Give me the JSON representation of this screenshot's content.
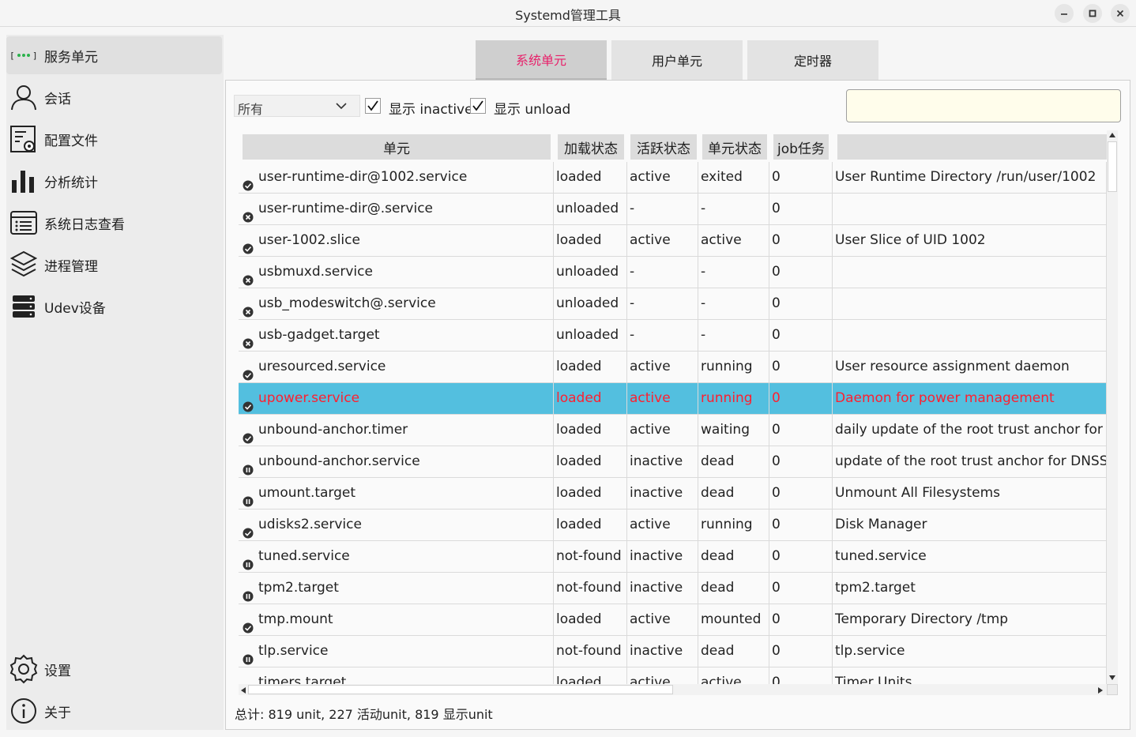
{
  "window": {
    "title": "Systemd管理工具"
  },
  "sidebar": {
    "items": [
      {
        "label": "服务单元",
        "icon": "service-units-icon"
      },
      {
        "label": "会话",
        "icon": "user-icon"
      },
      {
        "label": "配置文件",
        "icon": "config-file-icon"
      },
      {
        "label": "分析统计",
        "icon": "bar-chart-icon"
      },
      {
        "label": "系统日志查看",
        "icon": "log-list-icon"
      },
      {
        "label": "进程管理",
        "icon": "layers-icon"
      },
      {
        "label": "Udev设备",
        "icon": "server-icon"
      }
    ],
    "bottom": [
      {
        "label": "设置",
        "icon": "gear-icon"
      },
      {
        "label": "关于",
        "icon": "info-icon"
      }
    ]
  },
  "tabs": [
    {
      "label": "系统单元",
      "active": true
    },
    {
      "label": "用户单元",
      "active": false
    },
    {
      "label": "定时器",
      "active": false
    }
  ],
  "filter": {
    "selected": "所有",
    "show_inactive_label": "显示 inactive",
    "show_inactive": true,
    "show_unload_label": "显示 unload",
    "show_unload": true,
    "search_placeholder": ""
  },
  "table": {
    "columns": [
      "单元",
      "加载状态",
      "活跃状态",
      "单元状态",
      "job任务",
      ""
    ],
    "rows": [
      {
        "unit": "user-runtime-dir@1002.service",
        "load": "loaded",
        "active": "active",
        "sub": "exited",
        "job": "0",
        "desc": "User Runtime Directory /run/user/1002",
        "icon": "check"
      },
      {
        "unit": "user-runtime-dir@.service",
        "load": "unloaded",
        "active": "-",
        "sub": "-",
        "job": "0",
        "desc": "",
        "icon": "x"
      },
      {
        "unit": "user-1002.slice",
        "load": "loaded",
        "active": "active",
        "sub": "active",
        "job": "0",
        "desc": "User Slice of UID 1002",
        "icon": "check"
      },
      {
        "unit": "usbmuxd.service",
        "load": "unloaded",
        "active": "-",
        "sub": "-",
        "job": "0",
        "desc": "",
        "icon": "x"
      },
      {
        "unit": "usb_modeswitch@.service",
        "load": "unloaded",
        "active": "-",
        "sub": "-",
        "job": "0",
        "desc": "",
        "icon": "x"
      },
      {
        "unit": "usb-gadget.target",
        "load": "unloaded",
        "active": "-",
        "sub": "-",
        "job": "0",
        "desc": "",
        "icon": "x"
      },
      {
        "unit": "uresourced.service",
        "load": "loaded",
        "active": "active",
        "sub": "running",
        "job": "0",
        "desc": "User resource assignment daemon",
        "icon": "check"
      },
      {
        "unit": "upower.service",
        "load": "loaded",
        "active": "active",
        "sub": "running",
        "job": "0",
        "desc": "Daemon for power management",
        "icon": "check",
        "selected": true
      },
      {
        "unit": "unbound-anchor.timer",
        "load": "loaded",
        "active": "active",
        "sub": "waiting",
        "job": "0",
        "desc": "daily update of the root trust anchor for D",
        "icon": "check"
      },
      {
        "unit": "unbound-anchor.service",
        "load": "loaded",
        "active": "inactive",
        "sub": "dead",
        "job": "0",
        "desc": "update of the root trust anchor for DNSSI",
        "icon": "pause"
      },
      {
        "unit": "umount.target",
        "load": "loaded",
        "active": "inactive",
        "sub": "dead",
        "job": "0",
        "desc": "Unmount All Filesystems",
        "icon": "pause"
      },
      {
        "unit": "udisks2.service",
        "load": "loaded",
        "active": "active",
        "sub": "running",
        "job": "0",
        "desc": "Disk Manager",
        "icon": "check"
      },
      {
        "unit": "tuned.service",
        "load": "not-found",
        "active": "inactive",
        "sub": "dead",
        "job": "0",
        "desc": "tuned.service",
        "icon": "pause"
      },
      {
        "unit": "tpm2.target",
        "load": "not-found",
        "active": "inactive",
        "sub": "dead",
        "job": "0",
        "desc": "tpm2.target",
        "icon": "pause"
      },
      {
        "unit": "tmp.mount",
        "load": "loaded",
        "active": "active",
        "sub": "mounted",
        "job": "0",
        "desc": "Temporary Directory /tmp",
        "icon": "check"
      },
      {
        "unit": "tlp.service",
        "load": "not-found",
        "active": "inactive",
        "sub": "dead",
        "job": "0",
        "desc": "tlp.service",
        "icon": "pause"
      },
      {
        "unit": "timers.target",
        "load": "loaded",
        "active": "active",
        "sub": "active",
        "job": "0",
        "desc": "Timer Units",
        "icon": "check"
      }
    ]
  },
  "status": {
    "text": "总计: 819  unit, 227 活动unit, 819 显示unit"
  }
}
